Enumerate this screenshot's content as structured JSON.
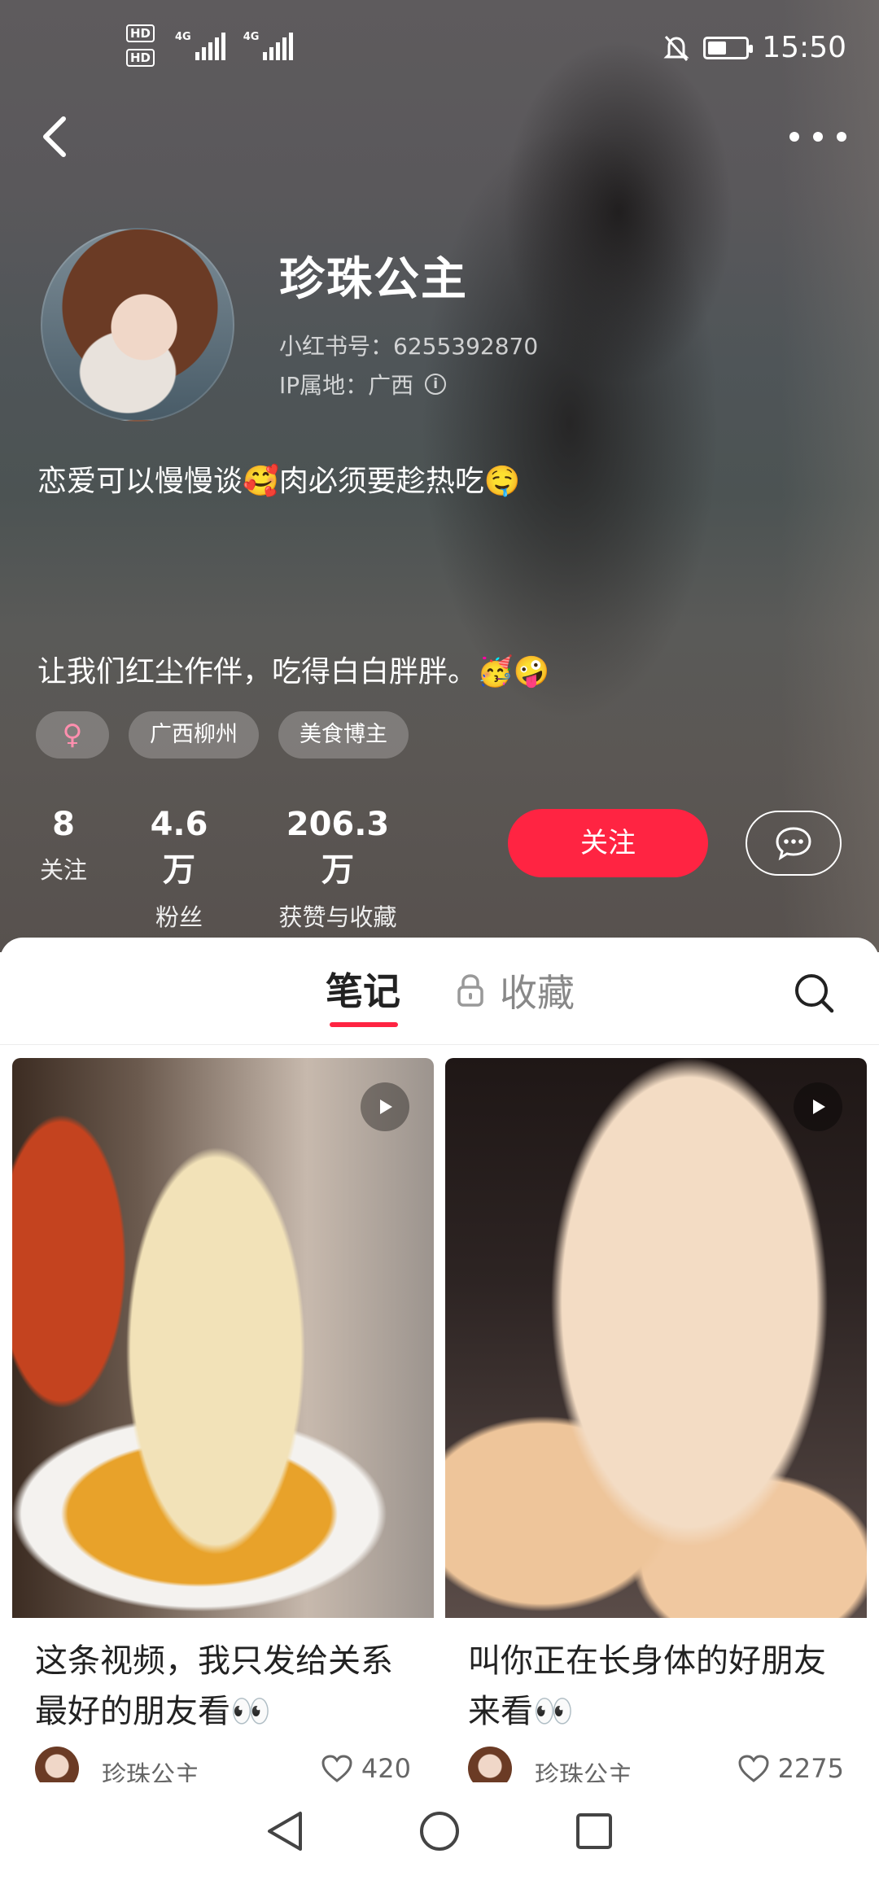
{
  "status_bar": {
    "hd1": "HD",
    "hd2": "HD",
    "net1": "4G",
    "net2": "4G",
    "time": "15:50"
  },
  "profile": {
    "name": "珍珠公主",
    "xhs_id": "小红书号：6255392870",
    "ip_location": "IP属地：广西",
    "bio_line1": "恋爱可以慢慢谈🥰肉必须要趁热吃🤤",
    "bio_line2": "让我们红尘作伴，吃得白白胖胖。🥳🤪",
    "tags": [
      {
        "label": "♀"
      },
      {
        "label": "广西柳州"
      },
      {
        "label": "美食博主"
      }
    ],
    "stats": [
      {
        "value": "8",
        "label": "关注"
      },
      {
        "value": "4.6 万",
        "label": "粉丝"
      },
      {
        "value": "206.3 万",
        "label": "获赞与收藏"
      }
    ],
    "follow_label": "关注"
  },
  "tabs": {
    "notes": "笔记",
    "favorites": "收藏"
  },
  "notes": [
    {
      "title": "这条视频，我只发给关系最好的朋友看👀",
      "author": "珍珠公主",
      "likes": "420"
    },
    {
      "title": "叫你正在长身体的好朋友来看👀",
      "author": "珍珠公主",
      "likes": "2275"
    }
  ],
  "colors": {
    "accent": "#ff2442",
    "tag_bg": "rgba(255,255,255,0.22)"
  },
  "icons": {
    "back": "back-arrow-icon",
    "more": "more-dots-icon",
    "message": "chat-bubble-icon",
    "lock": "lock-icon",
    "search": "search-icon",
    "play": "play-icon",
    "heart": "heart-icon"
  }
}
